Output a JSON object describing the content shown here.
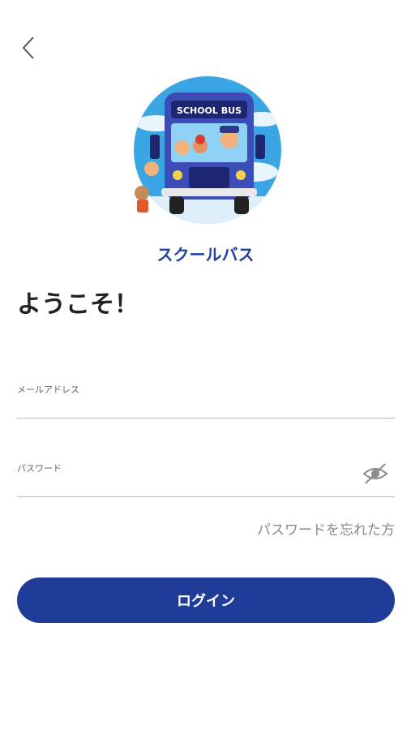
{
  "header": {
    "back_icon": "chevron-left-icon"
  },
  "app": {
    "name": "スクールバス",
    "logo_text": "SCHOOL BUS"
  },
  "welcome": "ようこそ！",
  "form": {
    "email_label": "メールアドレス",
    "email_value": "",
    "password_label": "パスワード",
    "password_value": "",
    "password_toggle_icon": "eye-slash-icon",
    "forgot_password": "パスワードを忘れた方",
    "login_label": "ログイン"
  },
  "colors": {
    "primary": "#1f3c99",
    "title": "#2141a0",
    "link": "#8a8a8a",
    "divider": "#b9b9b9"
  }
}
